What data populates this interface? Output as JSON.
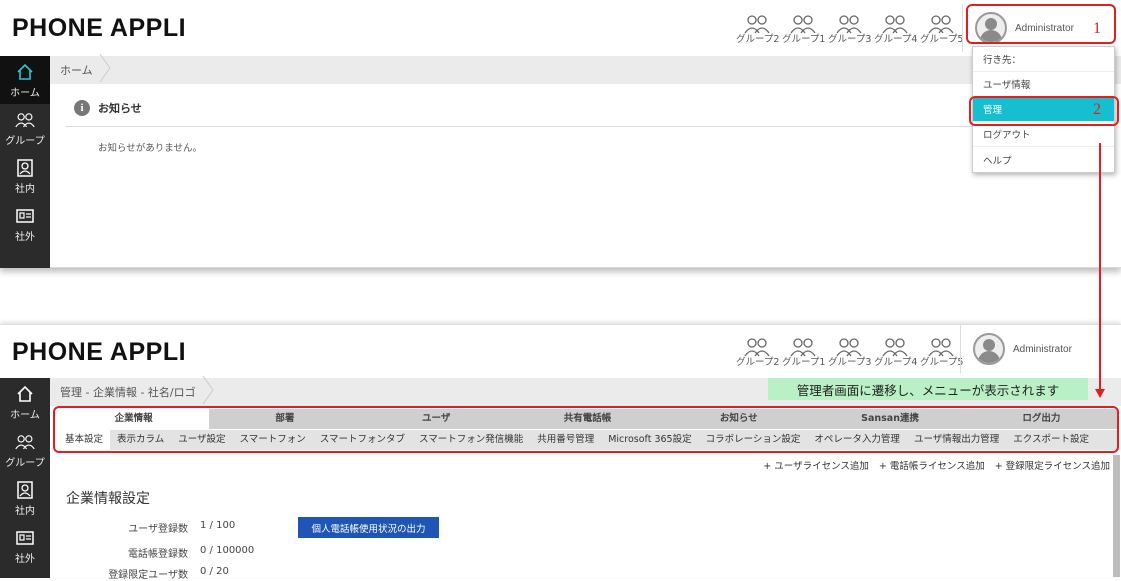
{
  "logo": "PHONE APPLI",
  "groups": [
    "グループ2",
    "グループ1",
    "グループ3",
    "グループ4",
    "グループ5"
  ],
  "user": {
    "name": "Administrator"
  },
  "sidebar": {
    "items": [
      {
        "label": "ホーム",
        "icon": "home-icon"
      },
      {
        "label": "グループ",
        "icon": "group-icon"
      },
      {
        "label": "社内",
        "icon": "contact-book-icon"
      },
      {
        "label": "社外",
        "icon": "business-card-icon"
      }
    ]
  },
  "top": {
    "breadcrumb": "ホーム",
    "notice_title": "お知らせ",
    "notice_empty": "お知らせがありません。"
  },
  "dropdown": {
    "items": [
      "行き先：",
      "ユーザ情報",
      "管理",
      "ログアウト",
      "ヘルプ"
    ],
    "active_index": 2
  },
  "annotations": {
    "step1": "1",
    "step2": "2",
    "note": "管理者画面に遷移し、メニューが表示されます",
    "color": "#e02020"
  },
  "bottom": {
    "breadcrumb": "管理 - 企業情報 - 社名/ロゴ",
    "main_tabs": [
      "企業情報",
      "部署",
      "ユーザ",
      "共有電話帳",
      "お知らせ",
      "Sansan連携",
      "ログ出力"
    ],
    "sub_tabs": [
      "基本設定",
      "表示カラム",
      "ユーザ設定",
      "スマートフォン",
      "スマートフォンタブ",
      "スマートフォン発信機能",
      "共用番号管理",
      "Microsoft 365設定",
      "コラボレーション設定",
      "オペレータ入力管理",
      "ユーザ情報出力管理",
      "エクスポート設定"
    ],
    "license_links": [
      "+ ユーザライセンス追加",
      "+ 電話帳ライセンス追加",
      "+ 登録限定ライセンス追加"
    ],
    "section_title": "企業情報設定",
    "stats": [
      {
        "label": "ユーザ登録数",
        "value": "1 / 100"
      },
      {
        "label": "電話帳登録数",
        "value": "0 / 100000"
      },
      {
        "label": "登録限定ユーザ数",
        "value": "0 / 20"
      }
    ],
    "export_button": "個人電話帳使用状況の出力"
  },
  "colors": {
    "accent": "#16bfcf",
    "button": "#1f56b5",
    "sidebar": "#2b2b2b"
  }
}
